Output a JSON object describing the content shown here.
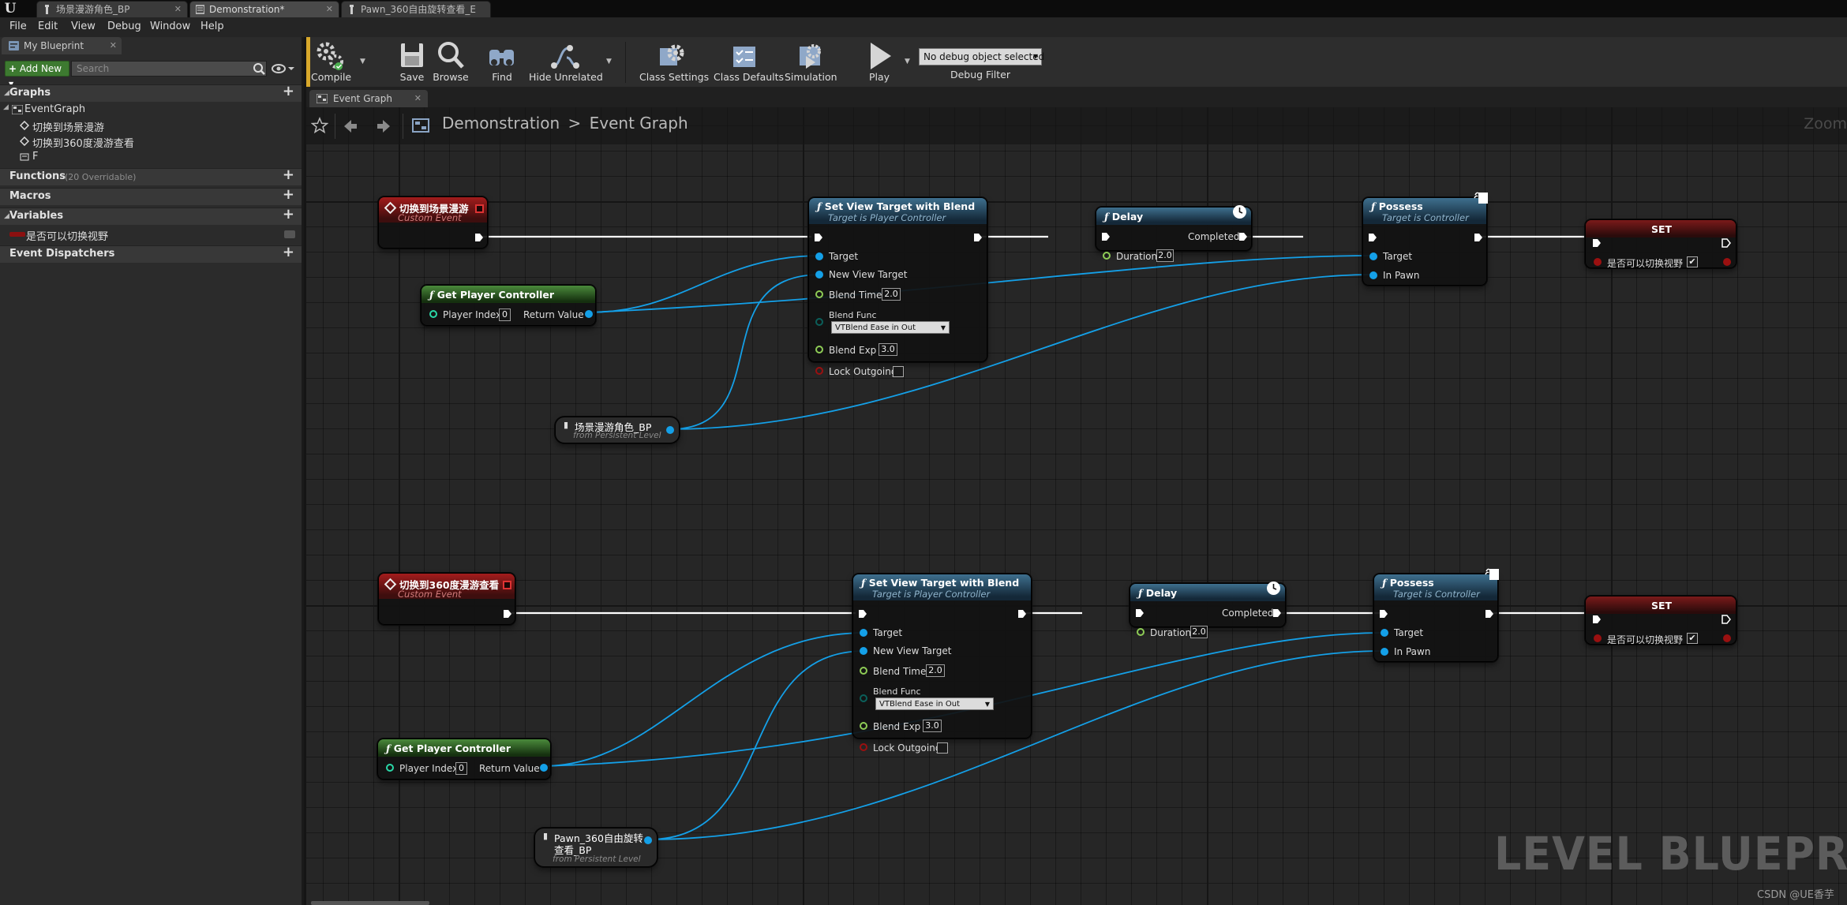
{
  "titlebar": {
    "tabs": [
      {
        "label": "场景漫游角色_BP"
      },
      {
        "label": "Demonstration*"
      },
      {
        "label": "Pawn_360自由旋转查看_E"
      }
    ]
  },
  "menu": {
    "items": [
      "File",
      "Edit",
      "View",
      "Debug",
      "Window",
      "Help"
    ]
  },
  "my_blueprint": {
    "tab_label": "My Blueprint",
    "add_new_label": "Add New",
    "search_placeholder": "Search",
    "graphs_label": "Graphs",
    "graph_tree": {
      "root": "EventGraph",
      "events": [
        "切换到场景漫游",
        "切换到360度漫游查看",
        "F"
      ]
    },
    "functions_label": "Functions",
    "functions_sub": "(20 Overridable)",
    "macros_label": "Macros",
    "variables_label": "Variables",
    "variables": [
      {
        "name": "是否可以切换视野",
        "color": "#8b1010"
      }
    ],
    "dispatchers_label": "Event Dispatchers"
  },
  "toolbar": {
    "compile": "Compile",
    "save": "Save",
    "browse": "Browse",
    "find": "Find",
    "hide_unrelated": "Hide Unrelated",
    "class_settings": "Class Settings",
    "class_defaults": "Class Defaults",
    "simulation": "Simulation",
    "play": "Play",
    "debug_object": "No debug object selected",
    "debug_filter": "Debug Filter"
  },
  "graph_tab": {
    "label": "Event Graph"
  },
  "breadcrumb": {
    "root": "Demonstration",
    "sep": ">",
    "current": "Event Graph",
    "zoom": "Zoom"
  },
  "watermark": "LEVEL BLUEPRINT",
  "credit": "CSDN @UE香芋",
  "accent": {
    "exec": "#ffffff",
    "object_wire": "#14a0e8",
    "event_red": "#a31c1c",
    "function_blue": "#3e6f8e",
    "pure_green": "#4a8a3b"
  },
  "nodes": {
    "ev1": {
      "title": "切换到场景漫游",
      "subtitle": "Custom Event"
    },
    "gpc1": {
      "title": "Get Player Controller",
      "pin_index": "Player Index",
      "index_value": "0",
      "pin_return": "Return Value"
    },
    "ref1": {
      "title": "场景漫游角色_BP",
      "subtitle": "from Persistent Level"
    },
    "svt1": {
      "title": "Set View Target with Blend",
      "subtitle": "Target is Player Controller",
      "pin_target": "Target",
      "pin_nvt": "New View Target",
      "pin_blend_time": "Blend Time",
      "blend_time": "2.0",
      "pin_blend_func": "Blend Func",
      "blend_func": "VTBlend Ease in Out",
      "pin_blend_exp": "Blend Exp",
      "blend_exp": "3.0",
      "pin_lock": "Lock Outgoing"
    },
    "delay1": {
      "title": "Delay",
      "pin_completed": "Completed",
      "pin_duration": "Duration",
      "duration": "2.0"
    },
    "poss1": {
      "title": "Possess",
      "subtitle": "Target is Controller",
      "pin_target": "Target",
      "pin_inpawn": "In Pawn"
    },
    "set1": {
      "title": "SET",
      "var": "是否可以切换视野",
      "checked": "✔"
    },
    "ev2": {
      "title": "切换到360度漫游查看",
      "subtitle": "Custom Event"
    },
    "gpc2": {
      "title": "Get Player Controller",
      "pin_index": "Player Index",
      "index_value": "0",
      "pin_return": "Return Value"
    },
    "ref2": {
      "title_line1": "Pawn_360自由旋转",
      "title_line2": "查看_BP",
      "subtitle": "from Persistent Level"
    },
    "svt2": {
      "title": "Set View Target with Blend",
      "subtitle": "Target is Player Controller",
      "pin_target": "Target",
      "pin_nvt": "New View Target",
      "pin_blend_time": "Blend Time",
      "blend_time": "2.0",
      "pin_blend_func": "Blend Func",
      "blend_func": "VTBlend Ease in Out",
      "pin_blend_exp": "Blend Exp",
      "blend_exp": "3.0",
      "pin_lock": "Lock Outgoing"
    },
    "delay2": {
      "title": "Delay",
      "pin_completed": "Completed",
      "pin_duration": "Duration",
      "duration": "2.0"
    },
    "poss2": {
      "title": "Possess",
      "subtitle": "Target is Controller",
      "pin_target": "Target",
      "pin_inpawn": "In Pawn"
    },
    "set2": {
      "title": "SET",
      "var": "是否可以切换视野",
      "checked": "✔"
    }
  }
}
